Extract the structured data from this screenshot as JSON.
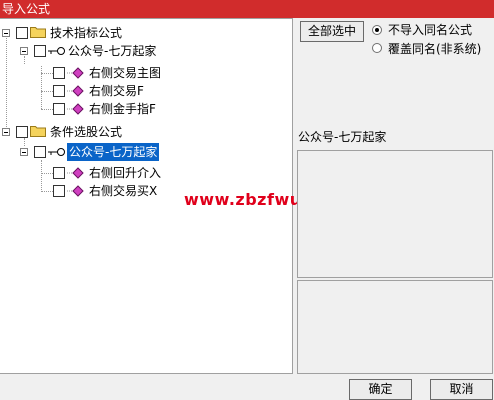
{
  "window": {
    "title": "导入公式"
  },
  "tree": {
    "groups": [
      {
        "label": "技术指标公式",
        "child": {
          "label": "公众号-七万起家",
          "items": [
            "右侧交易主图",
            "右侧交易F",
            "右侧金手指F"
          ]
        }
      },
      {
        "label": "条件选股公式",
        "child": {
          "label": "公众号-七万起家",
          "items": [
            "右侧回升介入",
            "右侧交易买X"
          ]
        }
      }
    ]
  },
  "watermark": "www.zbzfwu.com",
  "options": {
    "select_all_label": "全部选中",
    "radio": [
      {
        "label": "不导入同名公式",
        "selected": true
      },
      {
        "label": "覆盖同名(非系统)",
        "selected": false
      }
    ]
  },
  "info": {
    "selected_name": "公众号-七万起家"
  },
  "footer": {
    "ok_label": "确定",
    "cancel_label": "取消"
  },
  "colors": {
    "title_bar": "#d12c2c",
    "selection": "#0a64c8",
    "watermark": "#e0001b"
  }
}
